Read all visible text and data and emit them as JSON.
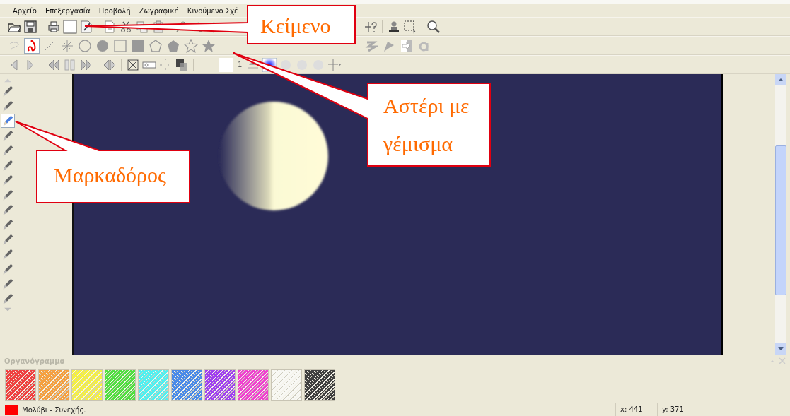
{
  "menu": [
    "Αρχείο",
    "Επεξεργασία",
    "Προβολή",
    "Ζωγραφική",
    "Κινούμενο Σχέ"
  ],
  "shape_tools": [
    {
      "selected": false
    },
    {
      "selected": true
    },
    {
      "selected": false
    },
    {
      "selected": false
    },
    {
      "selected": false
    },
    {
      "selected": false
    },
    {
      "selected": false
    },
    {
      "selected": false
    },
    {
      "selected": false
    },
    {
      "selected": false
    },
    {
      "selected": false
    },
    {
      "selected": false
    }
  ],
  "brush_size": "1",
  "brush_tools": [
    {
      "selected": false
    },
    {
      "selected": false
    },
    {
      "selected": true
    },
    {
      "selected": false
    },
    {
      "selected": false
    },
    {
      "selected": false
    },
    {
      "selected": false
    },
    {
      "selected": false
    },
    {
      "selected": false
    },
    {
      "selected": false
    },
    {
      "selected": false
    },
    {
      "selected": false
    },
    {
      "selected": false
    },
    {
      "selected": false
    },
    {
      "selected": false
    }
  ],
  "palette": {
    "title": "Οργανόγραμμα",
    "colors": [
      {
        "color": "#f04040"
      },
      {
        "color": "#f5a040"
      },
      {
        "color": "#f5f040"
      },
      {
        "color": "#50e040"
      },
      {
        "color": "#50f0f0"
      },
      {
        "color": "#4a8ae8"
      },
      {
        "color": "#a040f0"
      },
      {
        "color": "#f040d0"
      },
      {
        "color": "#f8f8f4"
      },
      {
        "color": "#404040"
      }
    ]
  },
  "status_bar": {
    "color": "#ff0000",
    "tool": "Μολύβι - Συνεχής.",
    "x": "x: 441",
    "y": "y: 371"
  },
  "callouts": [
    "Κείμενο",
    "Αστέρι με γέμισμα",
    "Μαρκαδόρος"
  ]
}
